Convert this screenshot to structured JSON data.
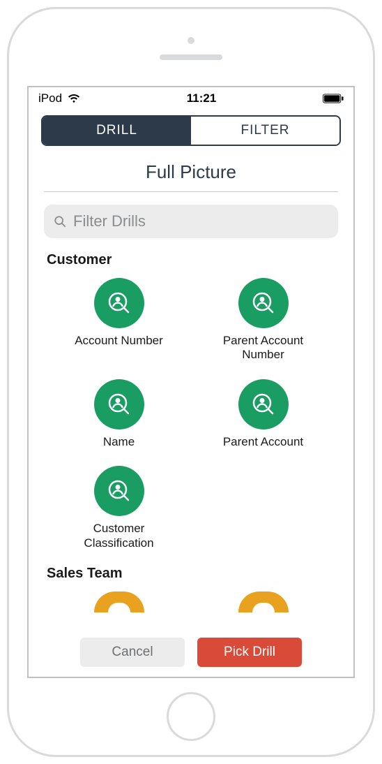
{
  "statusbar": {
    "device": "iPod",
    "time": "11:21"
  },
  "segmented": {
    "drill": "DRILL",
    "filter": "FILTER"
  },
  "title": "Full Picture",
  "search": {
    "placeholder": "Filter Drills"
  },
  "sections": {
    "customer": {
      "header": "Customer",
      "items": [
        {
          "label": "Account Number"
        },
        {
          "label": "Parent Account Number"
        },
        {
          "label": "Name"
        },
        {
          "label": "Parent Account"
        },
        {
          "label": "Customer Classification"
        }
      ]
    },
    "sales_team": {
      "header": "Sales Team"
    }
  },
  "footer": {
    "cancel": "Cancel",
    "pick": "Pick Drill"
  }
}
